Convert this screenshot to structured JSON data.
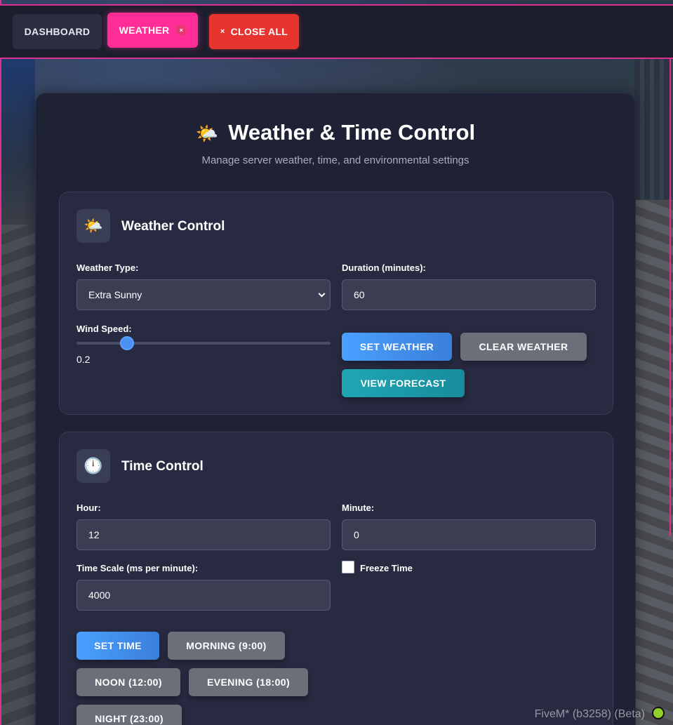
{
  "tabs": {
    "dashboard": "DASHBOARD",
    "weather": "WEATHER",
    "weather_close_glyph": "×",
    "close_all_glyph": "×",
    "close_all": "CLOSE ALL"
  },
  "page": {
    "title_emoji": "🌤️",
    "title": "Weather & Time Control",
    "subtitle": "Manage server weather, time, and environmental settings"
  },
  "weather": {
    "icon": "🌤️",
    "title": "Weather Control",
    "weather_type_label": "Weather Type:",
    "weather_type_value": "Extra Sunny",
    "duration_label": "Duration (minutes):",
    "duration_value": "60",
    "wind_speed_label": "Wind Speed:",
    "wind_speed_value": "0.2",
    "wind_speed_fraction": 0.2,
    "buttons": {
      "set": "SET WEATHER",
      "clear": "CLEAR WEATHER",
      "forecast": "VIEW FORECAST"
    }
  },
  "time": {
    "icon": "🕛",
    "title": "Time Control",
    "hour_label": "Hour:",
    "hour_value": "12",
    "minute_label": "Minute:",
    "minute_value": "0",
    "scale_label": "Time Scale (ms per minute):",
    "scale_value": "4000",
    "freeze_label": "Freeze Time",
    "freeze_checked": false,
    "buttons": {
      "set": "SET TIME",
      "morning": "MORNING (9:00)",
      "noon": "NOON (12:00)",
      "evening": "EVENING (18:00)",
      "night": "NIGHT (23:00)"
    }
  },
  "watermark": "FiveM* (b3258) (Beta)"
}
